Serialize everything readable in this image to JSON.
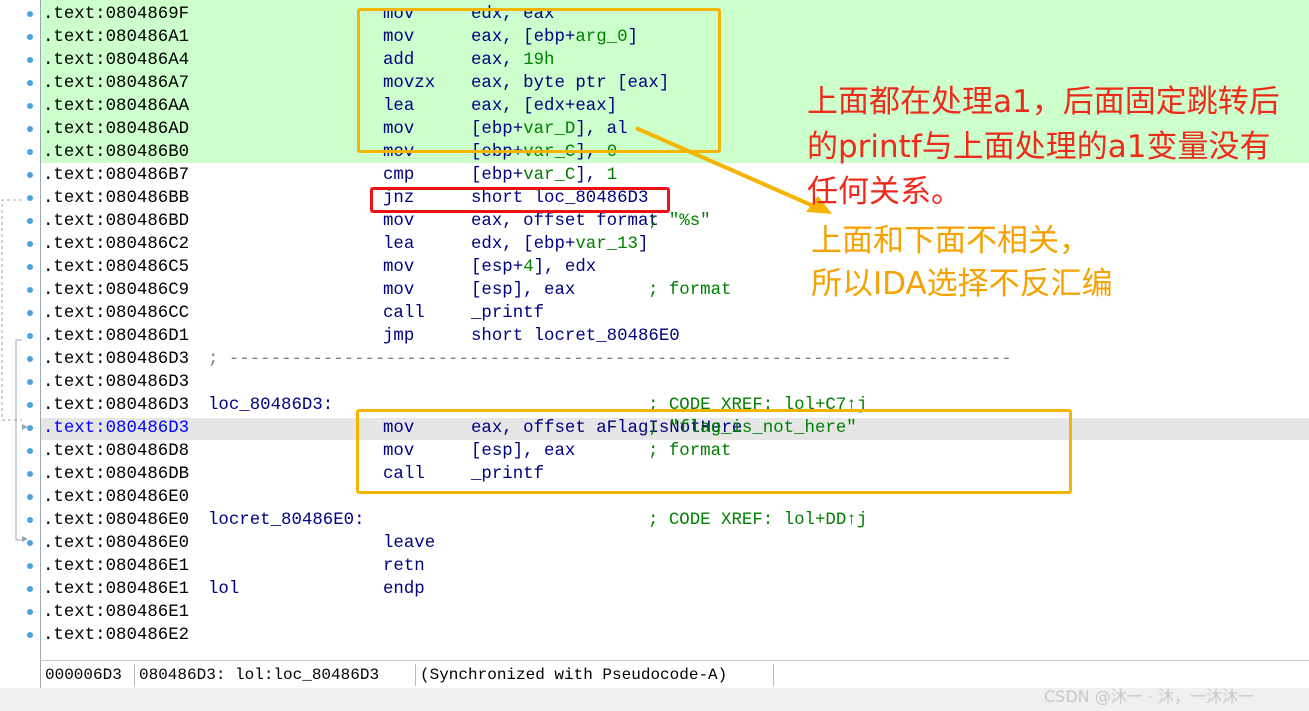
{
  "listing": {
    "lines": [
      {
        "addr": ".text:0804869F",
        "mn": "mov",
        "op": "edx, eax"
      },
      {
        "addr": ".text:080486A1",
        "mn": "mov",
        "op": "eax, [ebp+arg_0]"
      },
      {
        "addr": ".text:080486A4",
        "mn": "add",
        "op": "eax, 19h"
      },
      {
        "addr": ".text:080486A7",
        "mn": "movzx",
        "op": "eax, byte ptr [eax]"
      },
      {
        "addr": ".text:080486AA",
        "mn": "lea",
        "op": "eax, [edx+eax]"
      },
      {
        "addr": ".text:080486AD",
        "mn": "mov",
        "op": "[ebp+var_D], al"
      },
      {
        "addr": ".text:080486B0",
        "mn": "mov",
        "op": "[ebp+var_C], 0"
      },
      {
        "addr": ".text:080486B7",
        "mn": "cmp",
        "op": "[ebp+var_C], 1"
      },
      {
        "addr": ".text:080486BB",
        "mn": "jnz",
        "op": "short loc_80486D3"
      },
      {
        "addr": ".text:080486BD",
        "mn": "mov",
        "op": "eax, offset format",
        "comment": "; \"%s\""
      },
      {
        "addr": ".text:080486C2",
        "mn": "lea",
        "op": "edx, [ebp+var_13]"
      },
      {
        "addr": ".text:080486C5",
        "mn": "mov",
        "op": "[esp+4], edx"
      },
      {
        "addr": ".text:080486C9",
        "mn": "mov",
        "op": "[esp], eax",
        "comment": "; format"
      },
      {
        "addr": ".text:080486CC",
        "mn": "call",
        "op": "_printf"
      },
      {
        "addr": ".text:080486D1",
        "mn": "jmp",
        "op": "short locret_80486E0"
      },
      {
        "addr": ".text:080486D3",
        "sep": "; ---------------------------------------------------------------------------"
      },
      {
        "addr": ".text:080486D3"
      },
      {
        "addr": ".text:080486D3",
        "label": "loc_80486D3:",
        "comment": "; CODE XREF: lol+C7↑j"
      },
      {
        "addr": ".text:080486D3",
        "mn": "mov",
        "op": "eax, offset aFlagIsNotHere",
        "comment": "; \"flag_is_not_here\""
      },
      {
        "addr": ".text:080486D8",
        "mn": "mov",
        "op": "[esp], eax",
        "comment": "; format"
      },
      {
        "addr": ".text:080486DB",
        "mn": "call",
        "op": "_printf"
      },
      {
        "addr": ".text:080486E0"
      },
      {
        "addr": ".text:080486E0",
        "label": "locret_80486E0:",
        "comment": "; CODE XREF: lol+DD↑j"
      },
      {
        "addr": ".text:080486E0",
        "mn": "leave"
      },
      {
        "addr": ".text:080486E1",
        "mn": "retn"
      },
      {
        "addr": ".text:080486E1",
        "label": "lol",
        "mn": "endp"
      },
      {
        "addr": ".text:080486E1"
      },
      {
        "addr": ".text:080486E2"
      }
    ],
    "current_line_index": 18
  },
  "annotations": {
    "red_note": [
      "上面都在处理a1，后面固定跳转后",
      "的printf与上面处理的a1变量没有",
      "任何关系。"
    ],
    "orange_note": [
      "上面和下面不相关，",
      "所以IDA选择不反汇编"
    ]
  },
  "statusbar": {
    "offset": "000006D3",
    "location": "080486D3: lol:loc_80486D3",
    "sync": "(Synchronized with Pseudocode-A)"
  },
  "watermark": "CSDN @沐一 · 沐，一沐沐一",
  "colors": {
    "highlight_green": "#ccffcc",
    "box_orange": "#f5b400",
    "box_red": "#ee1111",
    "note_red": "#ee2a1a",
    "note_orange": "#f5a100",
    "address_blue": "#0000ff",
    "comment_green": "#008000"
  }
}
